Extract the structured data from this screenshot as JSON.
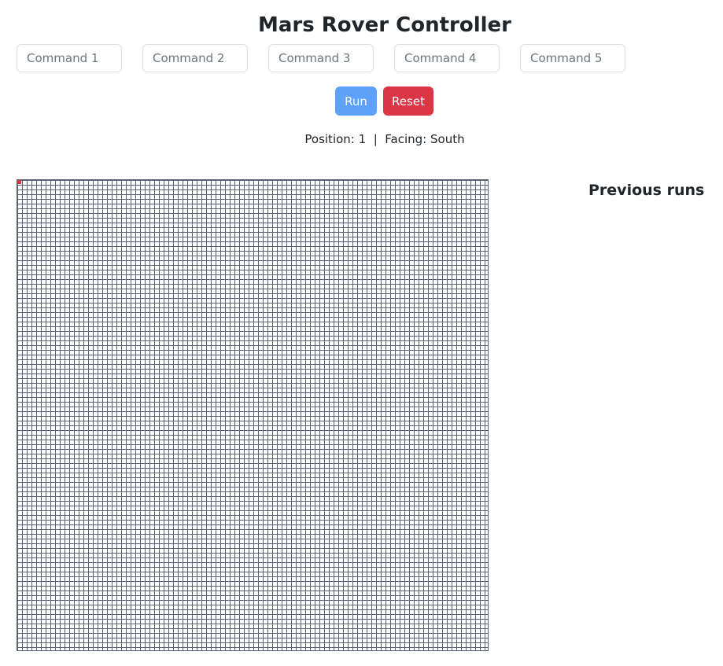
{
  "app": {
    "title": "Mars Rover Controller"
  },
  "commands": [
    {
      "placeholder": "Command 1",
      "value": ""
    },
    {
      "placeholder": "Command 2",
      "value": ""
    },
    {
      "placeholder": "Command 3",
      "value": ""
    },
    {
      "placeholder": "Command 4",
      "value": ""
    },
    {
      "placeholder": "Command 5",
      "value": ""
    }
  ],
  "buttons": {
    "run_label": "Run",
    "reset_label": "Reset"
  },
  "status": {
    "text": "Position: 1  |  Facing: South",
    "position": 1,
    "facing": "South"
  },
  "grid": {
    "rows": 100,
    "cols": 100,
    "rover_cell": 1,
    "rover_color": "#dc3545",
    "line_color": "#5b6275"
  },
  "history": {
    "heading": "Previous runs",
    "runs": []
  },
  "colors": {
    "primary": "#5ea1fb",
    "danger": "#dc3545"
  }
}
